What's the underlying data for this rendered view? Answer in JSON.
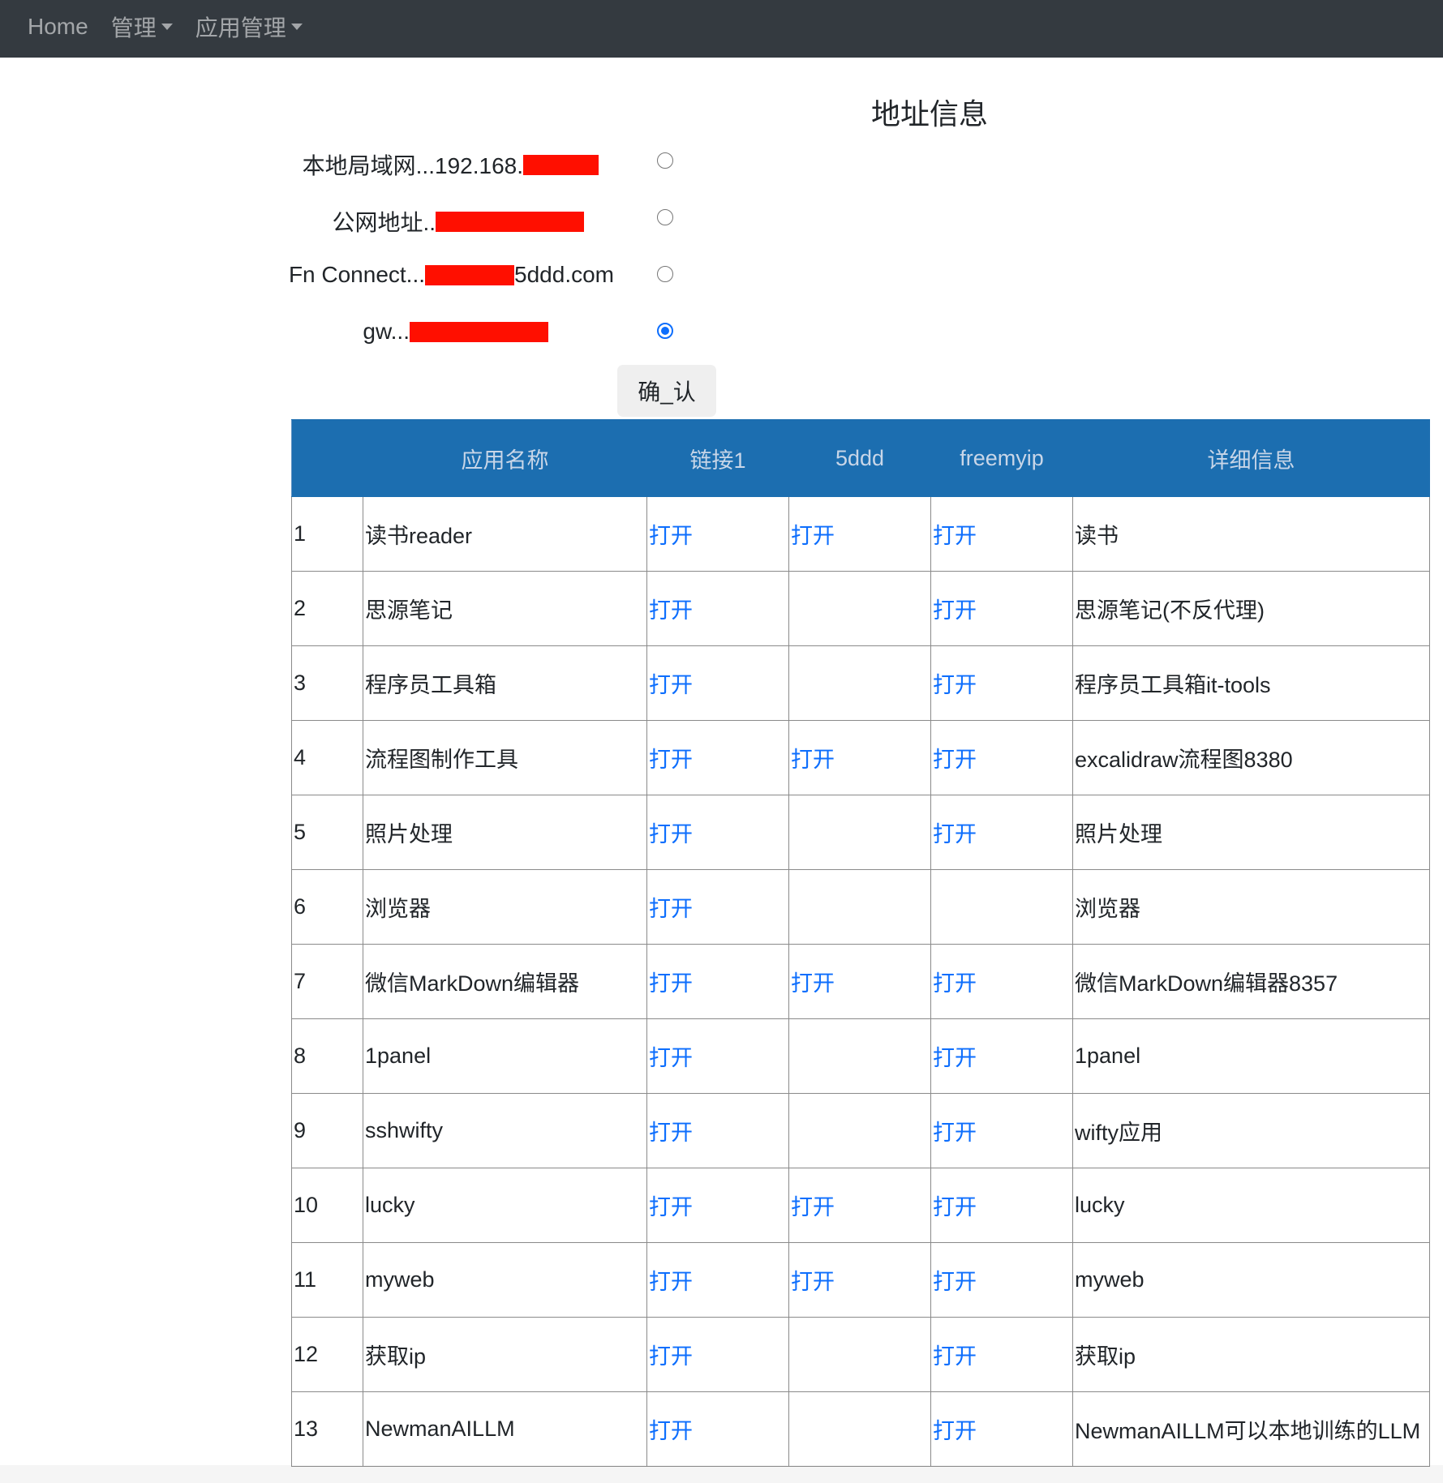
{
  "nav": {
    "home": "Home",
    "manage": "管理",
    "app_manage": "应用管理"
  },
  "title": "地址信息",
  "addresses": [
    {
      "label": "本地局域网...192.168.",
      "suffix": "",
      "selected": false
    },
    {
      "label": "公网地址..",
      "suffix": "",
      "selected": false
    },
    {
      "label": "Fn Connect...",
      "suffix": "5ddd.com",
      "selected": false
    },
    {
      "label": "gw...",
      "suffix": "",
      "selected": true
    }
  ],
  "confirm_label": "确_认",
  "table": {
    "headers": [
      "",
      "应用名称",
      "链接1",
      "5ddd",
      "freemyip",
      "详细信息"
    ],
    "link_text": "打开",
    "rows": [
      {
        "no": "1",
        "name": "读书reader",
        "l1": "打开",
        "l2": "打开",
        "l3": "打开",
        "detail": "读书"
      },
      {
        "no": "2",
        "name": "思源笔记",
        "l1": "打开",
        "l2": "",
        "l3": "打开",
        "detail": "思源笔记(不反代理)"
      },
      {
        "no": "3",
        "name": "程序员工具箱",
        "l1": "打开",
        "l2": "",
        "l3": "打开",
        "detail": "程序员工具箱it-tools"
      },
      {
        "no": "4",
        "name": "流程图制作工具",
        "l1": "打开",
        "l2": "打开",
        "l3": "打开",
        "detail": "excalidraw流程图8380"
      },
      {
        "no": "5",
        "name": "照片处理",
        "l1": "打开",
        "l2": "",
        "l3": "打开",
        "detail": "照片处理"
      },
      {
        "no": "6",
        "name": "浏览器",
        "l1": "打开",
        "l2": "",
        "l3": "",
        "detail": "浏览器"
      },
      {
        "no": "7",
        "name": "微信MarkDown编辑器",
        "l1": "打开",
        "l2": "打开",
        "l3": "打开",
        "detail": "微信MarkDown编辑器8357"
      },
      {
        "no": "8",
        "name": "1panel",
        "l1": "打开",
        "l2": "",
        "l3": "打开",
        "detail": "1panel"
      },
      {
        "no": "9",
        "name": "sshwifty",
        "l1": "打开",
        "l2": "",
        "l3": "打开",
        "detail": "wifty应用"
      },
      {
        "no": "10",
        "name": "lucky",
        "l1": "打开",
        "l2": "打开",
        "l3": "打开",
        "detail": "lucky"
      },
      {
        "no": "11",
        "name": "myweb",
        "l1": "打开",
        "l2": "打开",
        "l3": "打开",
        "detail": "myweb"
      },
      {
        "no": "12",
        "name": "获取ip",
        "l1": "打开",
        "l2": "",
        "l3": "打开",
        "detail": "获取ip"
      },
      {
        "no": "13",
        "name": "NewmanAILLM",
        "l1": "打开",
        "l2": "",
        "l3": "打开",
        "detail": "NewmanAILLM可以本地训练的LLM"
      }
    ]
  }
}
